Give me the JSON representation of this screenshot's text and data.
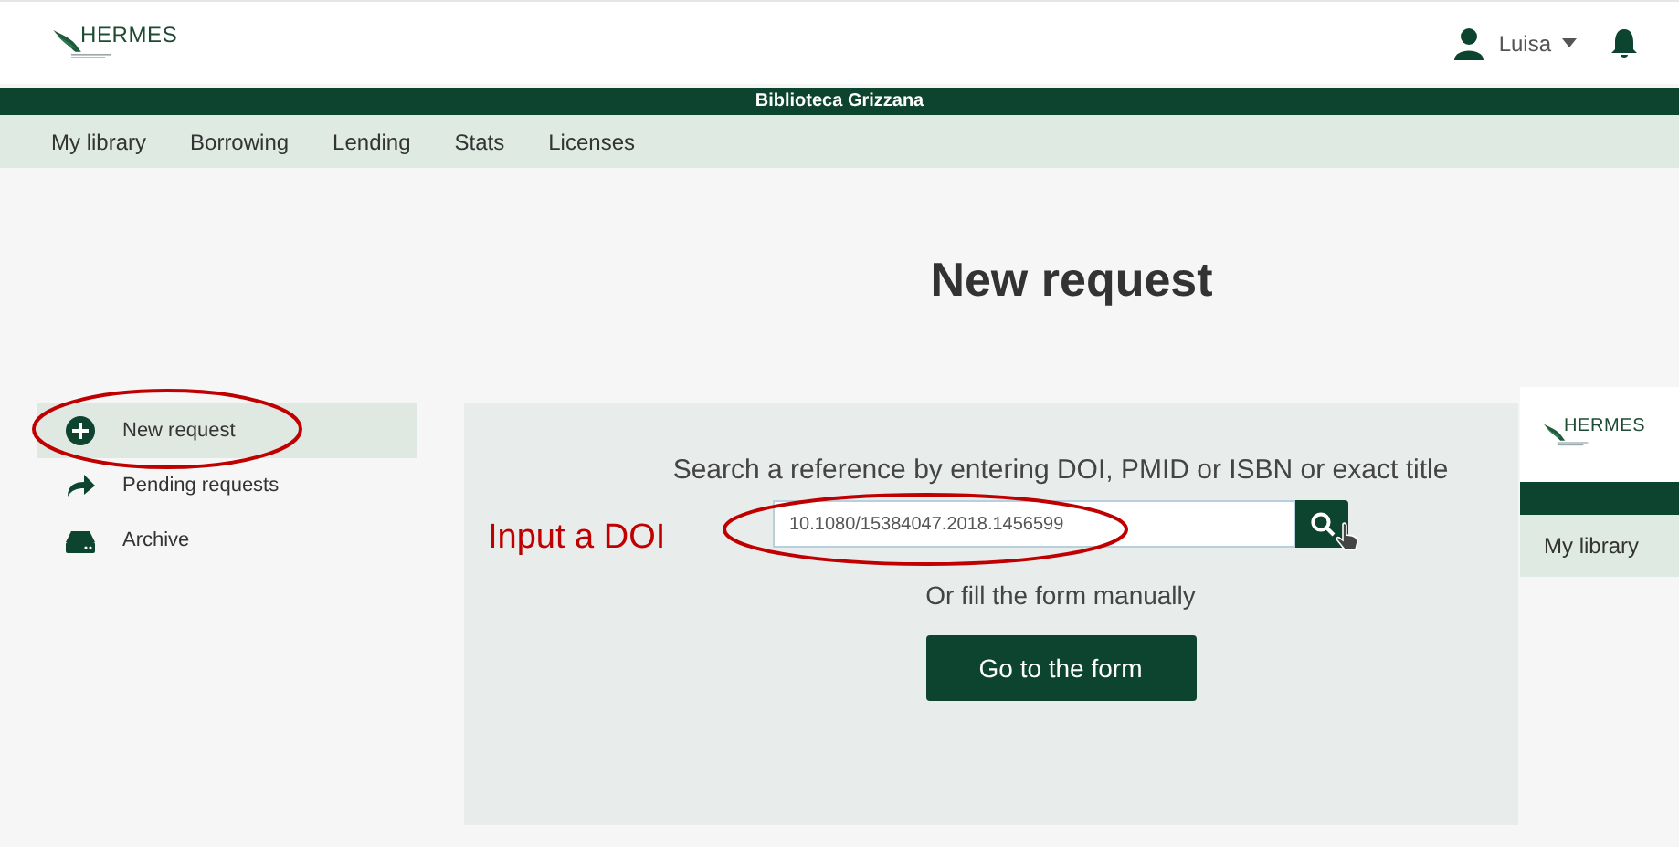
{
  "header": {
    "logo": "HERMES",
    "user": "Luisa"
  },
  "library_bar": {
    "title": "Biblioteca Grizzana"
  },
  "nav": {
    "items": [
      "My library",
      "Borrowing",
      "Lending",
      "Stats",
      "Licenses"
    ]
  },
  "page": {
    "title": "New request"
  },
  "sidebar": {
    "items": [
      {
        "kind": "new",
        "label": "New request",
        "selected": true
      },
      {
        "kind": "pending",
        "label": "Pending requests",
        "selected": false
      },
      {
        "kind": "archive",
        "label": "Archive",
        "selected": false
      }
    ]
  },
  "search": {
    "prompt": "Search a reference by entering DOI, PMID or ISBN or exact title",
    "value": "10.1080/15384047.2018.1456599",
    "alternative": "Or fill the form manually",
    "button": "Go to the form"
  },
  "inset_window": {
    "logo": "HERMES",
    "nav_item": "My library"
  },
  "annotation": {
    "label": "Input a DOI"
  }
}
